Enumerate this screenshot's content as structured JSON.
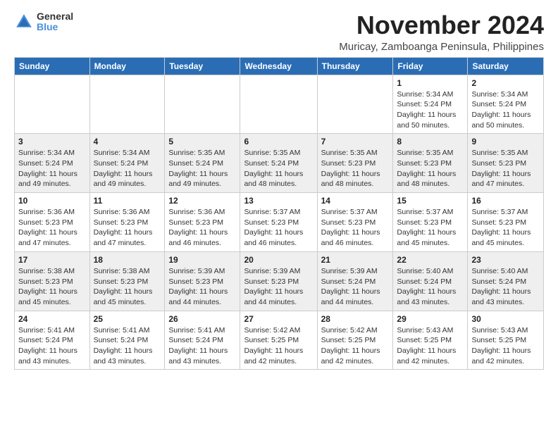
{
  "logo": {
    "general": "General",
    "blue": "Blue"
  },
  "title": "November 2024",
  "subtitle": "Muricay, Zamboanga Peninsula, Philippines",
  "days_header": [
    "Sunday",
    "Monday",
    "Tuesday",
    "Wednesday",
    "Thursday",
    "Friday",
    "Saturday"
  ],
  "weeks": [
    [
      {
        "day": "",
        "info": ""
      },
      {
        "day": "",
        "info": ""
      },
      {
        "day": "",
        "info": ""
      },
      {
        "day": "",
        "info": ""
      },
      {
        "day": "",
        "info": ""
      },
      {
        "day": "1",
        "info": "Sunrise: 5:34 AM\nSunset: 5:24 PM\nDaylight: 11 hours\nand 50 minutes."
      },
      {
        "day": "2",
        "info": "Sunrise: 5:34 AM\nSunset: 5:24 PM\nDaylight: 11 hours\nand 50 minutes."
      }
    ],
    [
      {
        "day": "3",
        "info": "Sunrise: 5:34 AM\nSunset: 5:24 PM\nDaylight: 11 hours\nand 49 minutes."
      },
      {
        "day": "4",
        "info": "Sunrise: 5:34 AM\nSunset: 5:24 PM\nDaylight: 11 hours\nand 49 minutes."
      },
      {
        "day": "5",
        "info": "Sunrise: 5:35 AM\nSunset: 5:24 PM\nDaylight: 11 hours\nand 49 minutes."
      },
      {
        "day": "6",
        "info": "Sunrise: 5:35 AM\nSunset: 5:24 PM\nDaylight: 11 hours\nand 48 minutes."
      },
      {
        "day": "7",
        "info": "Sunrise: 5:35 AM\nSunset: 5:23 PM\nDaylight: 11 hours\nand 48 minutes."
      },
      {
        "day": "8",
        "info": "Sunrise: 5:35 AM\nSunset: 5:23 PM\nDaylight: 11 hours\nand 48 minutes."
      },
      {
        "day": "9",
        "info": "Sunrise: 5:35 AM\nSunset: 5:23 PM\nDaylight: 11 hours\nand 47 minutes."
      }
    ],
    [
      {
        "day": "10",
        "info": "Sunrise: 5:36 AM\nSunset: 5:23 PM\nDaylight: 11 hours\nand 47 minutes."
      },
      {
        "day": "11",
        "info": "Sunrise: 5:36 AM\nSunset: 5:23 PM\nDaylight: 11 hours\nand 47 minutes."
      },
      {
        "day": "12",
        "info": "Sunrise: 5:36 AM\nSunset: 5:23 PM\nDaylight: 11 hours\nand 46 minutes."
      },
      {
        "day": "13",
        "info": "Sunrise: 5:37 AM\nSunset: 5:23 PM\nDaylight: 11 hours\nand 46 minutes."
      },
      {
        "day": "14",
        "info": "Sunrise: 5:37 AM\nSunset: 5:23 PM\nDaylight: 11 hours\nand 46 minutes."
      },
      {
        "day": "15",
        "info": "Sunrise: 5:37 AM\nSunset: 5:23 PM\nDaylight: 11 hours\nand 45 minutes."
      },
      {
        "day": "16",
        "info": "Sunrise: 5:37 AM\nSunset: 5:23 PM\nDaylight: 11 hours\nand 45 minutes."
      }
    ],
    [
      {
        "day": "17",
        "info": "Sunrise: 5:38 AM\nSunset: 5:23 PM\nDaylight: 11 hours\nand 45 minutes."
      },
      {
        "day": "18",
        "info": "Sunrise: 5:38 AM\nSunset: 5:23 PM\nDaylight: 11 hours\nand 45 minutes."
      },
      {
        "day": "19",
        "info": "Sunrise: 5:39 AM\nSunset: 5:23 PM\nDaylight: 11 hours\nand 44 minutes."
      },
      {
        "day": "20",
        "info": "Sunrise: 5:39 AM\nSunset: 5:23 PM\nDaylight: 11 hours\nand 44 minutes."
      },
      {
        "day": "21",
        "info": "Sunrise: 5:39 AM\nSunset: 5:24 PM\nDaylight: 11 hours\nand 44 minutes."
      },
      {
        "day": "22",
        "info": "Sunrise: 5:40 AM\nSunset: 5:24 PM\nDaylight: 11 hours\nand 43 minutes."
      },
      {
        "day": "23",
        "info": "Sunrise: 5:40 AM\nSunset: 5:24 PM\nDaylight: 11 hours\nand 43 minutes."
      }
    ],
    [
      {
        "day": "24",
        "info": "Sunrise: 5:41 AM\nSunset: 5:24 PM\nDaylight: 11 hours\nand 43 minutes."
      },
      {
        "day": "25",
        "info": "Sunrise: 5:41 AM\nSunset: 5:24 PM\nDaylight: 11 hours\nand 43 minutes."
      },
      {
        "day": "26",
        "info": "Sunrise: 5:41 AM\nSunset: 5:24 PM\nDaylight: 11 hours\nand 43 minutes."
      },
      {
        "day": "27",
        "info": "Sunrise: 5:42 AM\nSunset: 5:25 PM\nDaylight: 11 hours\nand 42 minutes."
      },
      {
        "day": "28",
        "info": "Sunrise: 5:42 AM\nSunset: 5:25 PM\nDaylight: 11 hours\nand 42 minutes."
      },
      {
        "day": "29",
        "info": "Sunrise: 5:43 AM\nSunset: 5:25 PM\nDaylight: 11 hours\nand 42 minutes."
      },
      {
        "day": "30",
        "info": "Sunrise: 5:43 AM\nSunset: 5:25 PM\nDaylight: 11 hours\nand 42 minutes."
      }
    ]
  ]
}
